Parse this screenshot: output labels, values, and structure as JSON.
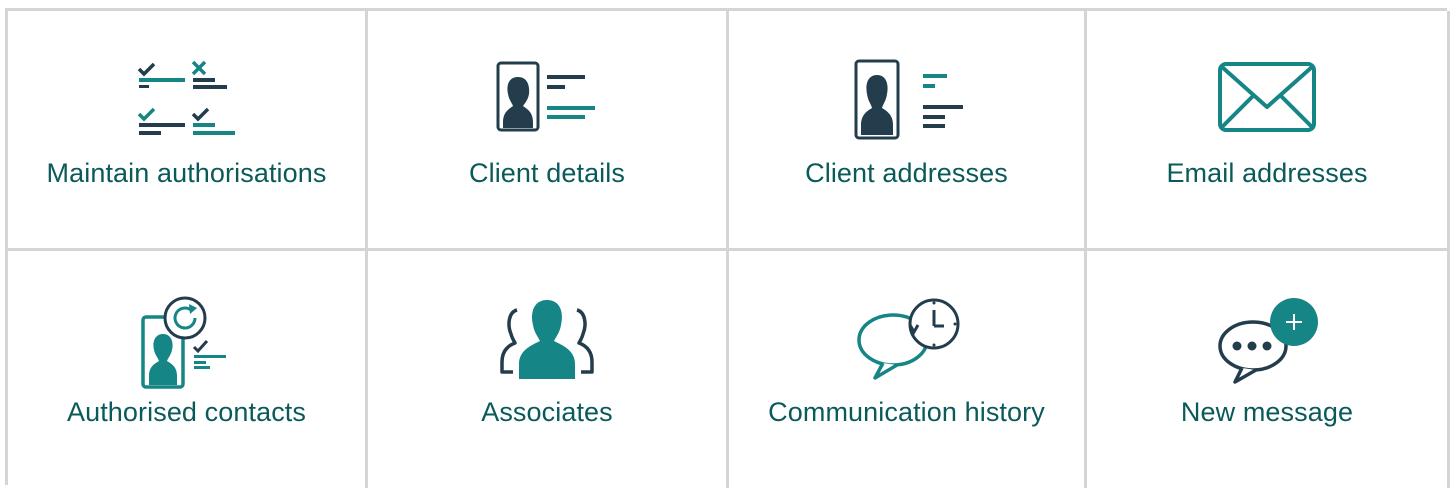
{
  "colors": {
    "teal": "#158585",
    "navy": "#233d4d",
    "label": "#0a5a5a",
    "border": "#d5d5d5"
  },
  "tiles": [
    {
      "label": "Maintain authorisations",
      "icon": "checklist-icon"
    },
    {
      "label": "Client details",
      "icon": "client-card-icon"
    },
    {
      "label": "Client addresses",
      "icon": "client-address-card-icon"
    },
    {
      "label": "Email addresses",
      "icon": "envelope-icon"
    },
    {
      "label": "Authorised contacts",
      "icon": "authorised-contact-refresh-icon"
    },
    {
      "label": "Associates",
      "icon": "people-group-icon"
    },
    {
      "label": "Communication history",
      "icon": "speech-bubble-clock-icon"
    },
    {
      "label": "New message",
      "icon": "speech-bubble-plus-icon"
    }
  ]
}
